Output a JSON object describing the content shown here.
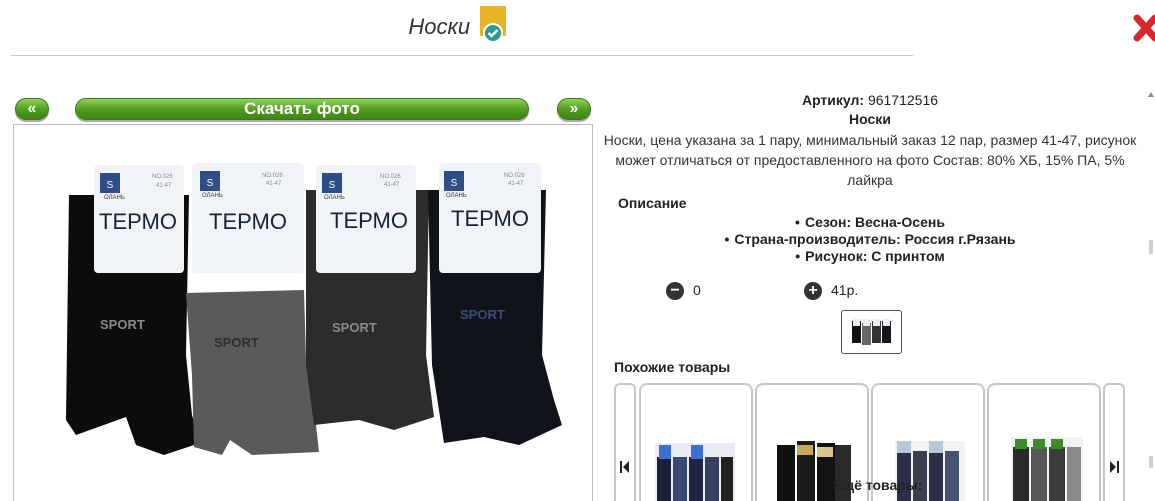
{
  "header": {
    "title": "Носки"
  },
  "nav": {
    "prev_label": "«",
    "download_label": "Скачать фото",
    "next_label": "»"
  },
  "product": {
    "article_label": "Артикул:",
    "article_value": "961712516",
    "name": "Носки",
    "description": "Носки, цена указана за 1 пару, минимальный заказ 12 пар, размер 41-47, рисунок может отличаться от предоставленного на фото Состав: 80% ХБ, 15% ПА, 5% лайкра",
    "section_label": "Описание",
    "attributes": [
      "Сезон: Весна-Осень",
      "Страна-производитель: Россия г.Рязань",
      "Рисунок: С принтом"
    ]
  },
  "purchase": {
    "quantity": "0",
    "price": "41р."
  },
  "photo": {
    "labels": [
      "ТЕРМО",
      "ТЕРМО",
      "ТЕРМО",
      "ТЕРМО"
    ],
    "sport_text": "SPORT",
    "brand": "ОЛАНЬ",
    "codes": [
      "NO.026",
      "NO.026",
      "NO.026",
      "NO.026"
    ],
    "sizes": [
      "41-47",
      "41-47",
      "41-47",
      "41-47"
    ],
    "sock_colors": [
      "#0c0c0c",
      "#5a5a5a",
      "#2c2c2c",
      "#11131a"
    ]
  },
  "similar": {
    "title": "Похожие товары"
  },
  "more": {
    "title": "Ещё товары:"
  },
  "colors": {
    "accent_green": "#4e9a1e",
    "close_red": "#d9262b",
    "badge_yellow": "#e8b428",
    "badge_teal": "#2a9a8a"
  }
}
